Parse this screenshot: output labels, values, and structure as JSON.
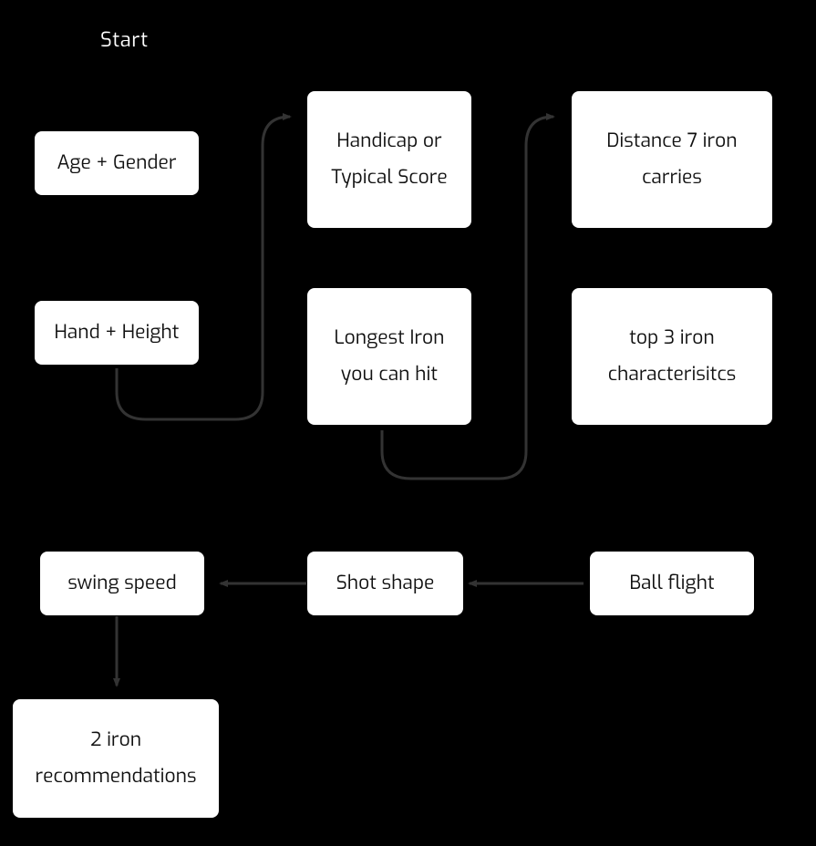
{
  "diagram": {
    "start_label": "Start",
    "nodes": {
      "age_gender": "Age + Gender",
      "hand_height": "Hand + Height",
      "handicap": "Handicap or Typical Score",
      "longest_iron": "Longest Iron you can hit",
      "distance_7iron": "Distance 7 iron carries",
      "top3_chars": "top 3 iron characterisitcs",
      "shot_shape": "Shot shape",
      "ball_flight": "Ball flight",
      "swing_speed": "swing speed",
      "recommendations": "2 iron recommendations"
    }
  }
}
